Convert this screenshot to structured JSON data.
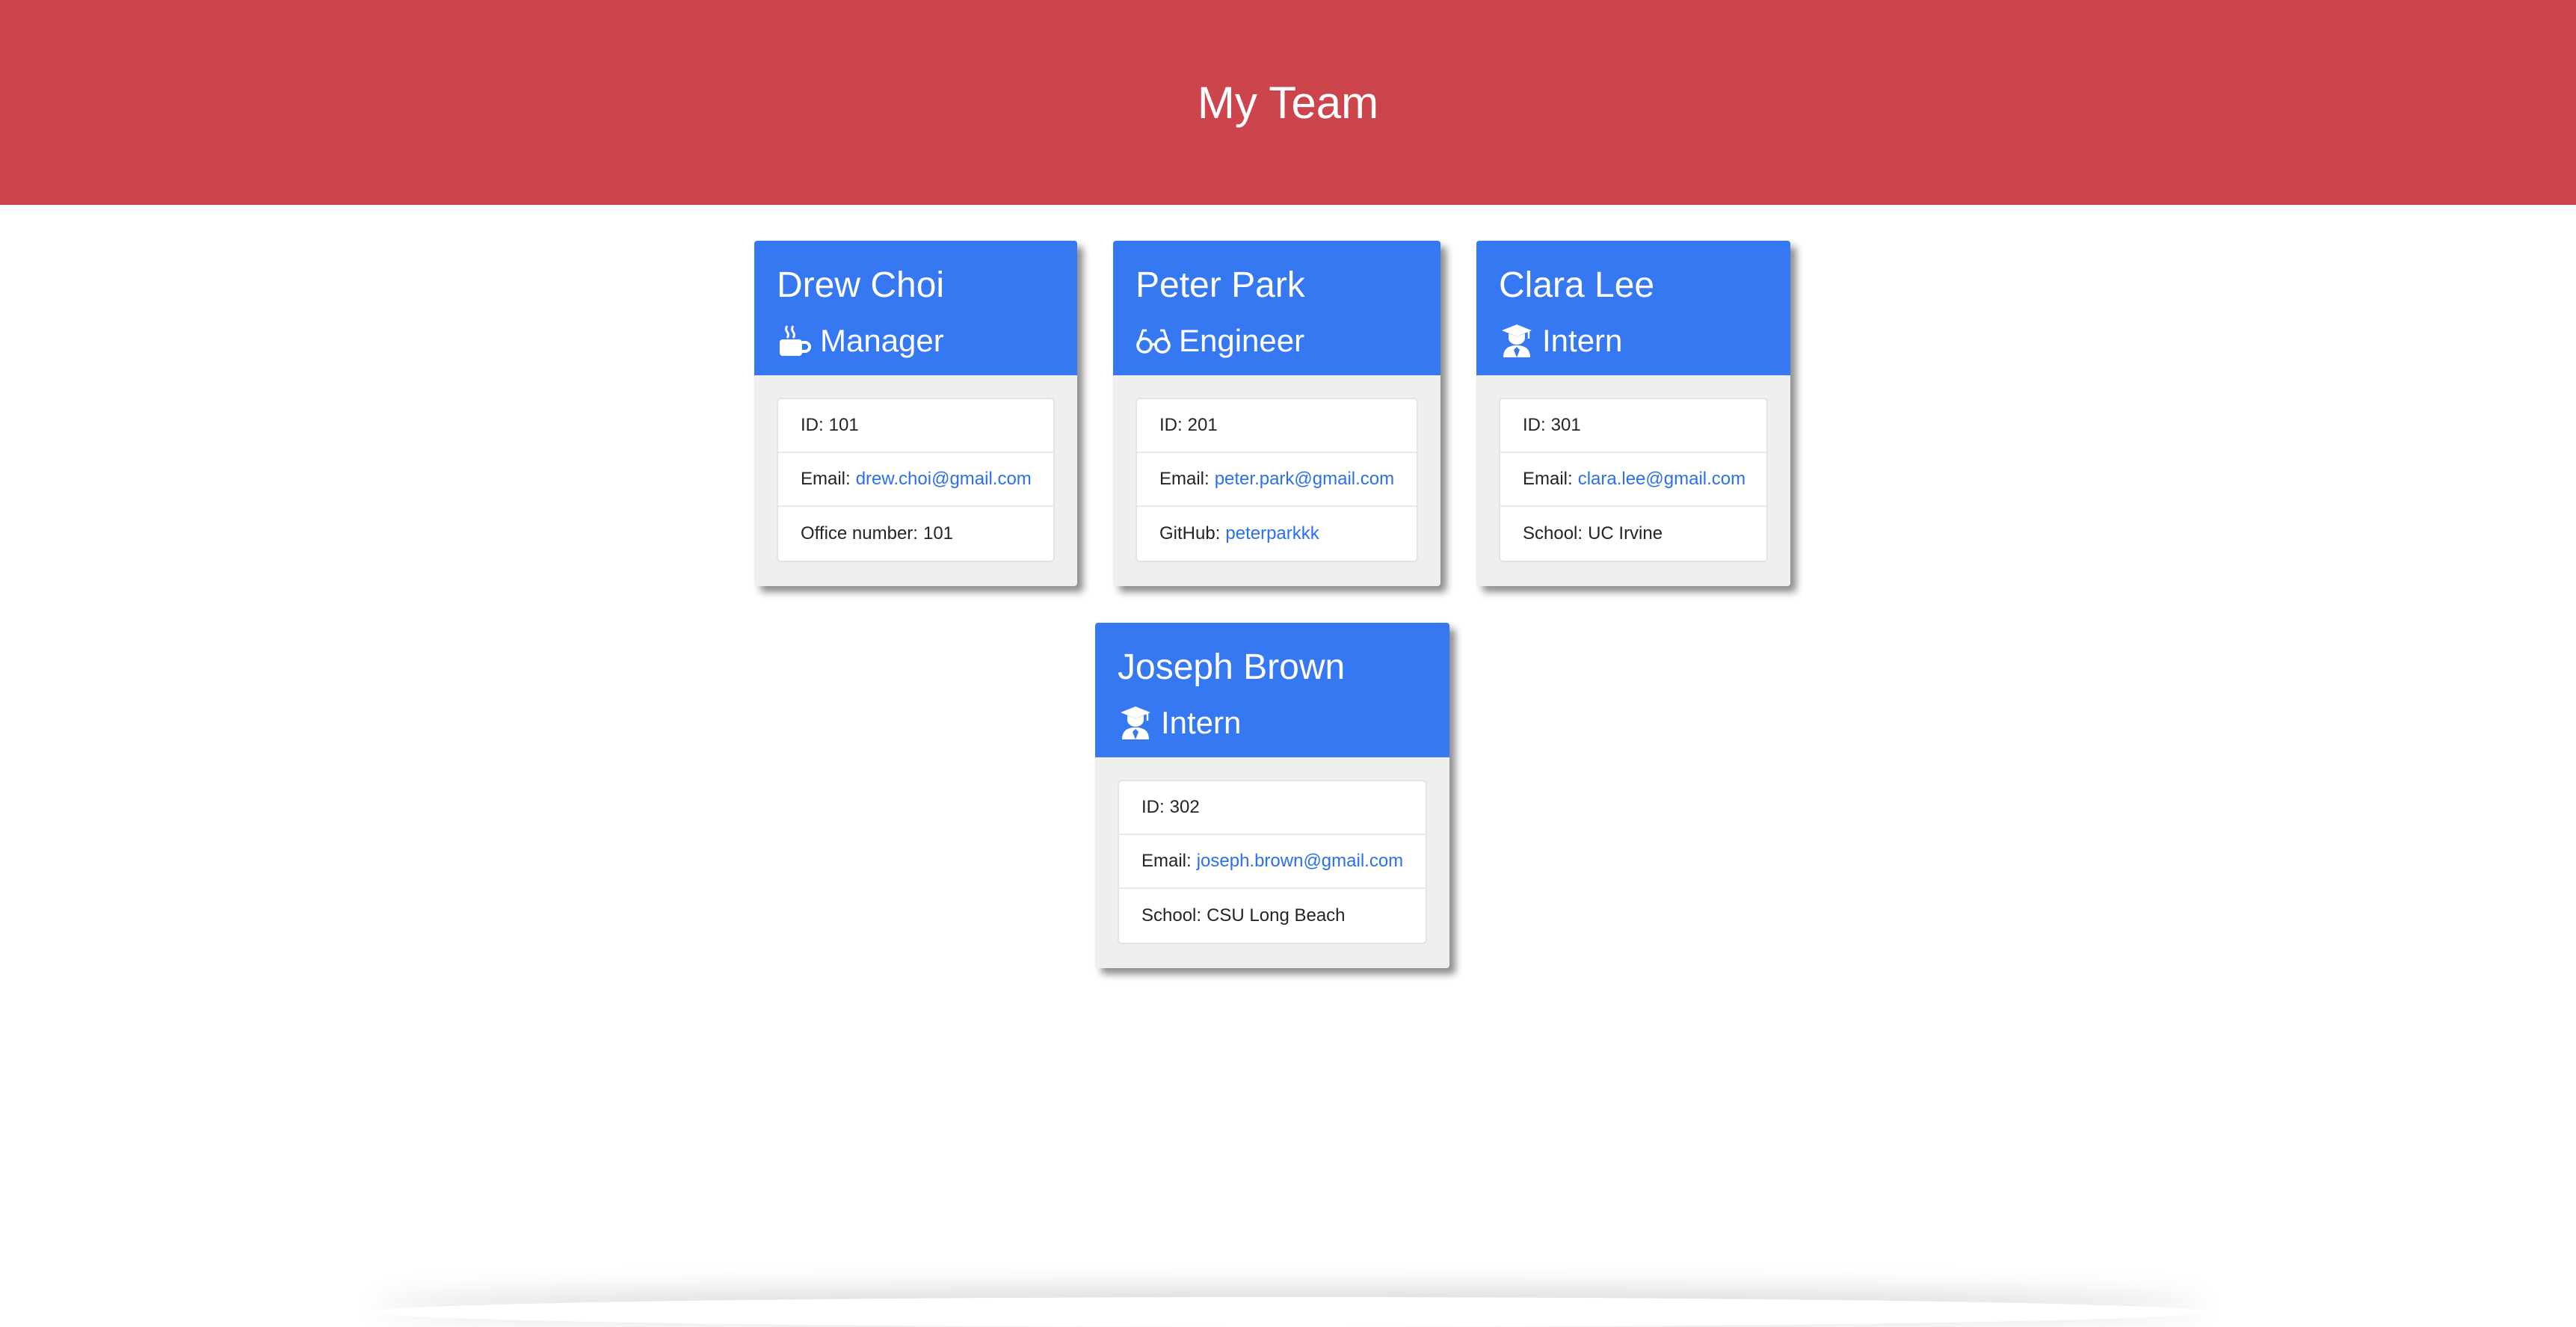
{
  "header": {
    "title": "My Team"
  },
  "team": [
    {
      "name": "Drew Choi",
      "role": "Manager",
      "role_icon": "coffee-icon",
      "id_label": "ID:",
      "id": "101",
      "email_label": "Email:",
      "email": "drew.choi@gmail.com",
      "extra_label": "Office number:",
      "extra": "101"
    },
    {
      "name": "Peter Park",
      "role": "Engineer",
      "role_icon": "glasses-icon",
      "id_label": "ID:",
      "id": "201",
      "email_label": "Email:",
      "email": "peter.park@gmail.com",
      "extra_label": "GitHub:",
      "extra": "peterparkkk"
    },
    {
      "name": "Clara Lee",
      "role": "Intern",
      "role_icon": "graduate-icon",
      "id_label": "ID:",
      "id": "301",
      "email_label": "Email:",
      "email": "clara.lee@gmail.com",
      "extra_label": "School:",
      "extra": "UC Irvine"
    },
    {
      "name": "Joseph Brown",
      "role": "Intern",
      "role_icon": "graduate-icon",
      "id_label": "ID:",
      "id": "302",
      "email_label": "Email:",
      "email": "joseph.brown@gmail.com",
      "extra_label": "School:",
      "extra": "CSU Long Beach"
    }
  ],
  "colors": {
    "header_bg": "#cd454c",
    "card_head_bg": "#3578f2",
    "link": "#2a6ff0"
  }
}
